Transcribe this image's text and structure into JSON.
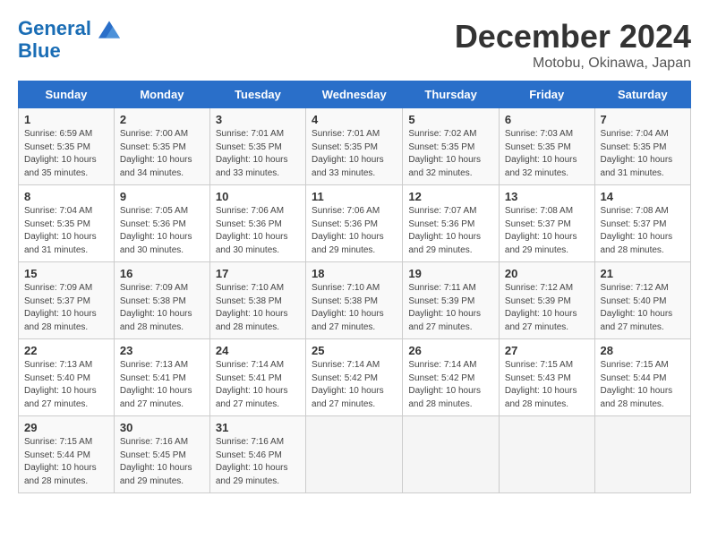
{
  "logo": {
    "line1": "General",
    "line2": "Blue"
  },
  "title": "December 2024",
  "location": "Motobu, Okinawa, Japan",
  "weekdays": [
    "Sunday",
    "Monday",
    "Tuesday",
    "Wednesday",
    "Thursday",
    "Friday",
    "Saturday"
  ],
  "weeks": [
    [
      {
        "day": "1",
        "info": "Sunrise: 6:59 AM\nSunset: 5:35 PM\nDaylight: 10 hours\nand 35 minutes."
      },
      {
        "day": "2",
        "info": "Sunrise: 7:00 AM\nSunset: 5:35 PM\nDaylight: 10 hours\nand 34 minutes."
      },
      {
        "day": "3",
        "info": "Sunrise: 7:01 AM\nSunset: 5:35 PM\nDaylight: 10 hours\nand 33 minutes."
      },
      {
        "day": "4",
        "info": "Sunrise: 7:01 AM\nSunset: 5:35 PM\nDaylight: 10 hours\nand 33 minutes."
      },
      {
        "day": "5",
        "info": "Sunrise: 7:02 AM\nSunset: 5:35 PM\nDaylight: 10 hours\nand 32 minutes."
      },
      {
        "day": "6",
        "info": "Sunrise: 7:03 AM\nSunset: 5:35 PM\nDaylight: 10 hours\nand 32 minutes."
      },
      {
        "day": "7",
        "info": "Sunrise: 7:04 AM\nSunset: 5:35 PM\nDaylight: 10 hours\nand 31 minutes."
      }
    ],
    [
      {
        "day": "8",
        "info": "Sunrise: 7:04 AM\nSunset: 5:35 PM\nDaylight: 10 hours\nand 31 minutes."
      },
      {
        "day": "9",
        "info": "Sunrise: 7:05 AM\nSunset: 5:36 PM\nDaylight: 10 hours\nand 30 minutes."
      },
      {
        "day": "10",
        "info": "Sunrise: 7:06 AM\nSunset: 5:36 PM\nDaylight: 10 hours\nand 30 minutes."
      },
      {
        "day": "11",
        "info": "Sunrise: 7:06 AM\nSunset: 5:36 PM\nDaylight: 10 hours\nand 29 minutes."
      },
      {
        "day": "12",
        "info": "Sunrise: 7:07 AM\nSunset: 5:36 PM\nDaylight: 10 hours\nand 29 minutes."
      },
      {
        "day": "13",
        "info": "Sunrise: 7:08 AM\nSunset: 5:37 PM\nDaylight: 10 hours\nand 29 minutes."
      },
      {
        "day": "14",
        "info": "Sunrise: 7:08 AM\nSunset: 5:37 PM\nDaylight: 10 hours\nand 28 minutes."
      }
    ],
    [
      {
        "day": "15",
        "info": "Sunrise: 7:09 AM\nSunset: 5:37 PM\nDaylight: 10 hours\nand 28 minutes."
      },
      {
        "day": "16",
        "info": "Sunrise: 7:09 AM\nSunset: 5:38 PM\nDaylight: 10 hours\nand 28 minutes."
      },
      {
        "day": "17",
        "info": "Sunrise: 7:10 AM\nSunset: 5:38 PM\nDaylight: 10 hours\nand 28 minutes."
      },
      {
        "day": "18",
        "info": "Sunrise: 7:10 AM\nSunset: 5:38 PM\nDaylight: 10 hours\nand 27 minutes."
      },
      {
        "day": "19",
        "info": "Sunrise: 7:11 AM\nSunset: 5:39 PM\nDaylight: 10 hours\nand 27 minutes."
      },
      {
        "day": "20",
        "info": "Sunrise: 7:12 AM\nSunset: 5:39 PM\nDaylight: 10 hours\nand 27 minutes."
      },
      {
        "day": "21",
        "info": "Sunrise: 7:12 AM\nSunset: 5:40 PM\nDaylight: 10 hours\nand 27 minutes."
      }
    ],
    [
      {
        "day": "22",
        "info": "Sunrise: 7:13 AM\nSunset: 5:40 PM\nDaylight: 10 hours\nand 27 minutes."
      },
      {
        "day": "23",
        "info": "Sunrise: 7:13 AM\nSunset: 5:41 PM\nDaylight: 10 hours\nand 27 minutes."
      },
      {
        "day": "24",
        "info": "Sunrise: 7:14 AM\nSunset: 5:41 PM\nDaylight: 10 hours\nand 27 minutes."
      },
      {
        "day": "25",
        "info": "Sunrise: 7:14 AM\nSunset: 5:42 PM\nDaylight: 10 hours\nand 27 minutes."
      },
      {
        "day": "26",
        "info": "Sunrise: 7:14 AM\nSunset: 5:42 PM\nDaylight: 10 hours\nand 28 minutes."
      },
      {
        "day": "27",
        "info": "Sunrise: 7:15 AM\nSunset: 5:43 PM\nDaylight: 10 hours\nand 28 minutes."
      },
      {
        "day": "28",
        "info": "Sunrise: 7:15 AM\nSunset: 5:44 PM\nDaylight: 10 hours\nand 28 minutes."
      }
    ],
    [
      {
        "day": "29",
        "info": "Sunrise: 7:15 AM\nSunset: 5:44 PM\nDaylight: 10 hours\nand 28 minutes."
      },
      {
        "day": "30",
        "info": "Sunrise: 7:16 AM\nSunset: 5:45 PM\nDaylight: 10 hours\nand 29 minutes."
      },
      {
        "day": "31",
        "info": "Sunrise: 7:16 AM\nSunset: 5:46 PM\nDaylight: 10 hours\nand 29 minutes."
      },
      null,
      null,
      null,
      null
    ]
  ]
}
